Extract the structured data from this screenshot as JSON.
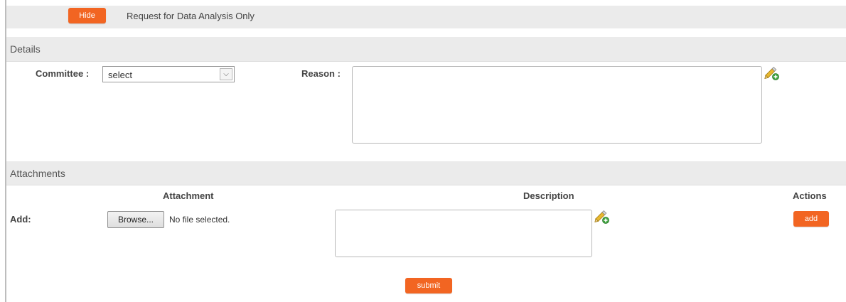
{
  "header": {
    "hide_label": "Hide",
    "title": "Request for Data Analysis Only"
  },
  "details": {
    "section_title": "Details",
    "committee_label": "Committee :",
    "committee_value": "select",
    "reason_label": "Reason :",
    "reason_value": ""
  },
  "attachments": {
    "section_title": "Attachments",
    "col_attachment": "Attachment",
    "col_description": "Description",
    "col_actions": "Actions",
    "add_row_label": "Add:",
    "browse_label": "Browse...",
    "no_file_text": "No file selected.",
    "description_value": "",
    "add_label": "add"
  },
  "form": {
    "submit_label": "submit"
  },
  "icons": {
    "reason_edit": "pencil-add-icon",
    "description_edit": "pencil-add-icon",
    "select_arrow": "chevron-down-icon"
  },
  "colors": {
    "accent": "#f26522",
    "band": "#ebebeb"
  }
}
